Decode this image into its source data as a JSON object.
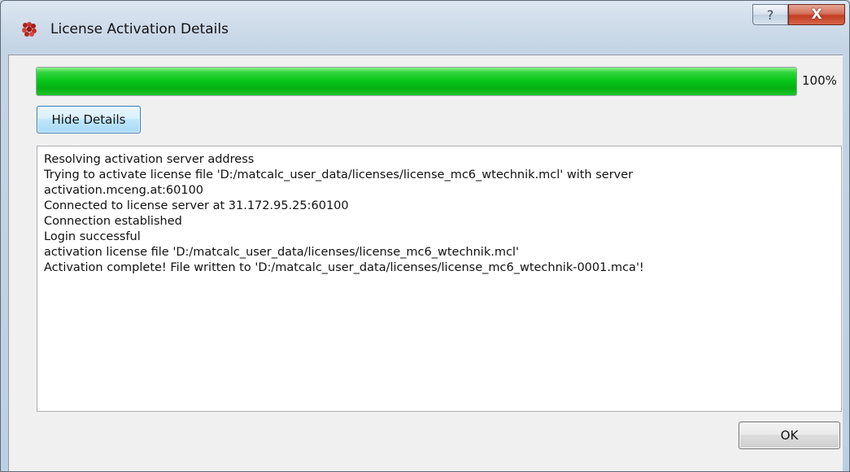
{
  "window": {
    "title": "License Activation Details",
    "help_label": "?",
    "close_label": "X"
  },
  "progress": {
    "value": 1.0,
    "text": "100%",
    "color": "#0ac41a"
  },
  "buttons": {
    "hide_details": "Hide Details",
    "ok": "OK"
  },
  "log": {
    "lines": [
      "Resolving activation server address",
      "Trying to activate license file 'D:/matcalc_user_data/licenses/license_mc6_wtechnik.mcl' with server",
      "activation.mceng.at:60100",
      "Connected to license server at 31.172.95.25:60100",
      "Connection established",
      "Login successful",
      "activation license file 'D:/matcalc_user_data/licenses/license_mc6_wtechnik.mcl'",
      "Activation complete! File written to 'D:/matcalc_user_data/licenses/license_mc6_wtechnik-0001.mca'!"
    ]
  },
  "icons": {
    "app": "matcalc-app-icon",
    "help": "help-icon",
    "close": "close-icon"
  }
}
